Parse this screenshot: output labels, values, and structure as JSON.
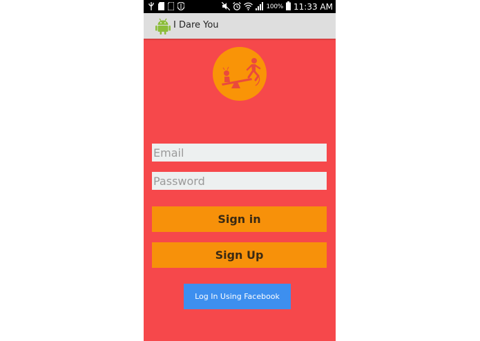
{
  "status_bar": {
    "battery_level": "100%",
    "time": "11:33 AM",
    "left_icons": [
      "usb-icon",
      "sd-card-icon",
      "shield-icon"
    ],
    "right_icons": [
      "mute-icon",
      "alarm-icon",
      "wifi-icon",
      "signal-icon",
      "battery-icon"
    ]
  },
  "action_bar": {
    "app_icon": "android-icon",
    "title": "I Dare You"
  },
  "logo": {
    "icon": "seesaw-icon",
    "color": "#f99407"
  },
  "form": {
    "email_placeholder": "Email",
    "password_placeholder": "Password",
    "sign_in_label": "Sign in",
    "sign_up_label": "Sign Up",
    "facebook_label": "Log In Using Facebook"
  },
  "colors": {
    "background": "#f6484b",
    "orange_button": "#f7910a",
    "facebook_button": "#3d8fef",
    "input_background": "#edf0f0"
  }
}
